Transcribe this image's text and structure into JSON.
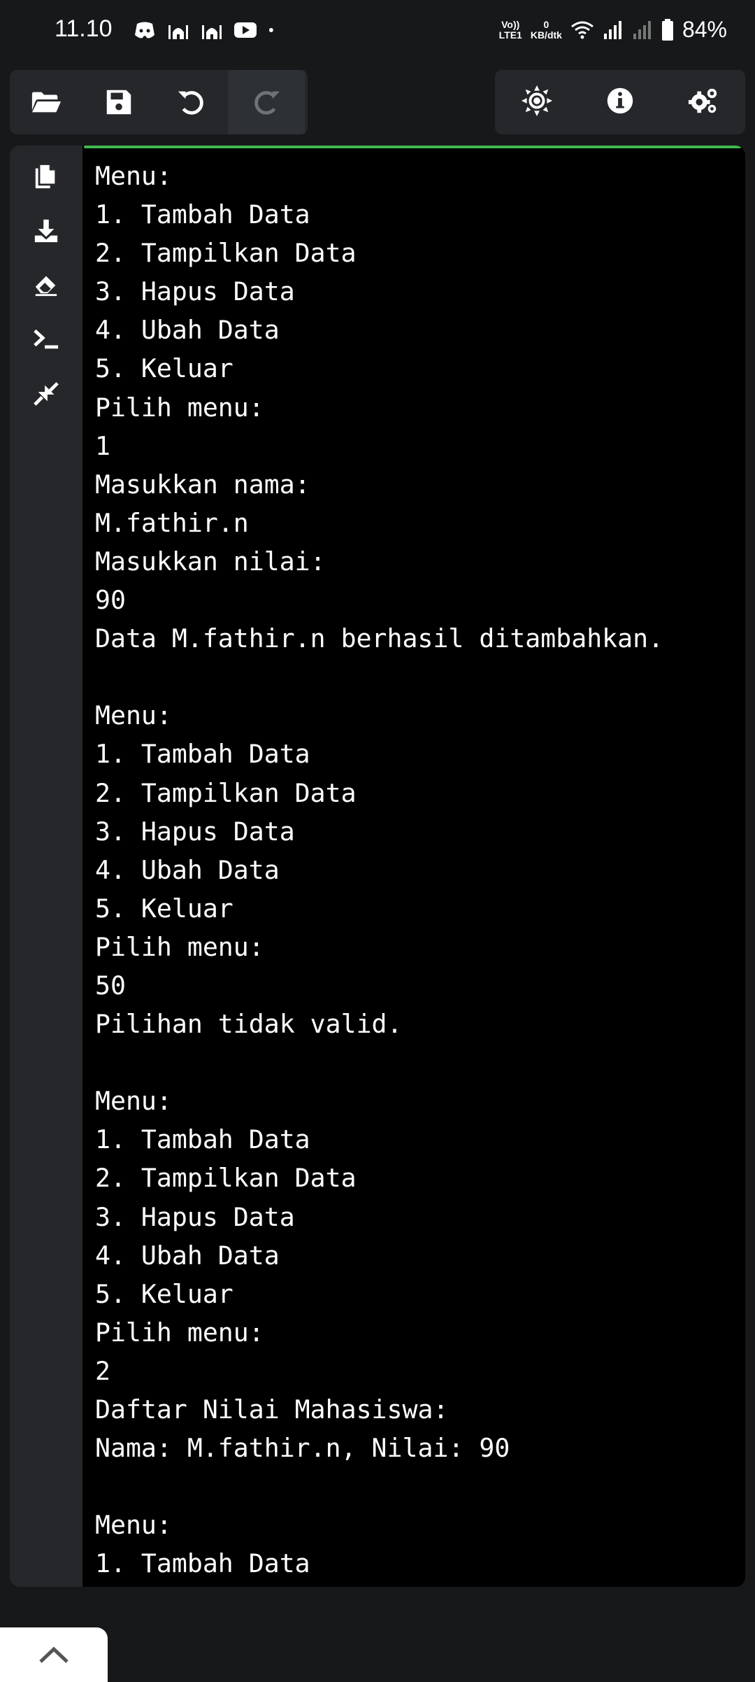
{
  "status_bar": {
    "time": "11.10",
    "network_label": "LTE1",
    "volte_label": "Vo))",
    "speed_value": "0",
    "speed_unit": "KB/dtk",
    "battery": "84%"
  },
  "toolbar": {
    "left": [
      "open-folder-icon",
      "save-icon",
      "undo-icon",
      "redo-icon"
    ],
    "right": [
      "theme-sun-icon",
      "info-icon",
      "settings-gears-icon"
    ]
  },
  "side_rail": [
    "copy-icon",
    "download-icon",
    "eraser-icon",
    "terminal-icon",
    "collapse-icon"
  ],
  "console": {
    "lines": [
      "Menu:",
      "1. Tambah Data",
      "2. Tampilkan Data",
      "3. Hapus Data",
      "4. Ubah Data",
      "5. Keluar",
      "Pilih menu:",
      "1",
      "Masukkan nama:",
      "M.fathir.n",
      "Masukkan nilai:",
      "90",
      "Data M.fathir.n berhasil ditambahkan.",
      "",
      "Menu:",
      "1. Tambah Data",
      "2. Tampilkan Data",
      "3. Hapus Data",
      "4. Ubah Data",
      "5. Keluar",
      "Pilih menu:",
      "50",
      "Pilihan tidak valid.",
      "",
      "Menu:",
      "1. Tambah Data",
      "2. Tampilkan Data",
      "3. Hapus Data",
      "4. Ubah Data",
      "5. Keluar",
      "Pilih menu:",
      "2",
      "Daftar Nilai Mahasiswa:",
      "Nama: M.fathir.n, Nilai: 90",
      "",
      "Menu:",
      "1. Tambah Data"
    ]
  },
  "colors": {
    "background": "#17181a",
    "panel": "#25272b",
    "console_bg": "#000000",
    "accent_line": "#3fb950"
  }
}
